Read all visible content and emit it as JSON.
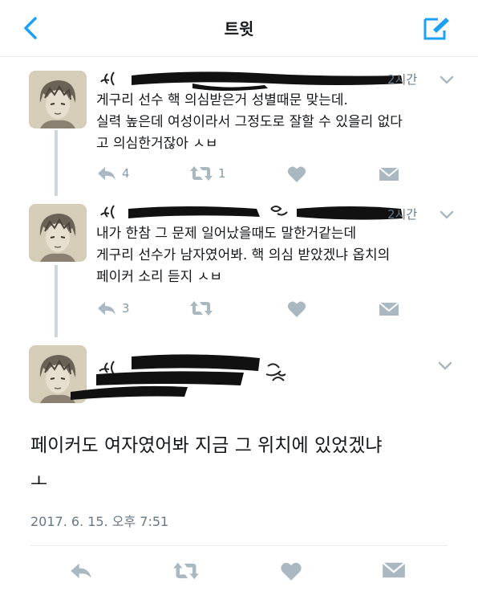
{
  "header": {
    "title": "트윗"
  },
  "tweets": [
    {
      "time": "2시간",
      "text_lines": [
        "게구리 선수 핵 의심받은거 성별때문 맞는데.",
        "실력 높은데 여성이라서 그정도로 잘할 수 있을리 없다",
        "고 의심한거잖아 ㅅㅂ"
      ],
      "reply_count": "4",
      "retweet_count": "1",
      "like_count": ""
    },
    {
      "time": "2시간",
      "text_lines": [
        "내가 한참 그 문제 일어났을때도 말한거같는데",
        "게구리 선수가 남자였어봐. 핵 의심 받았겠냐 옵치의",
        "페이커 소리 듣지 ㅅㅂ"
      ],
      "reply_count": "3",
      "retweet_count": "",
      "like_count": ""
    }
  ],
  "main_tweet": {
    "text_lines": [
      "페이커도 여자였어봐 지금 그 위치에 있었겠냐",
      "ㅗ"
    ],
    "timestamp": "2017. 6. 15. 오후 7:51"
  },
  "icons": {
    "back": "chevron-left-icon",
    "compose": "compose-tweet-icon",
    "reply": "reply-icon",
    "retweet": "retweet-icon",
    "like": "heart-icon",
    "dm": "envelope-icon",
    "caret": "chevron-down-icon"
  },
  "colors": {
    "accent": "#1da1f2",
    "icon_gray": "#aab8c2",
    "text": "#14171a",
    "secondary": "#657786"
  }
}
